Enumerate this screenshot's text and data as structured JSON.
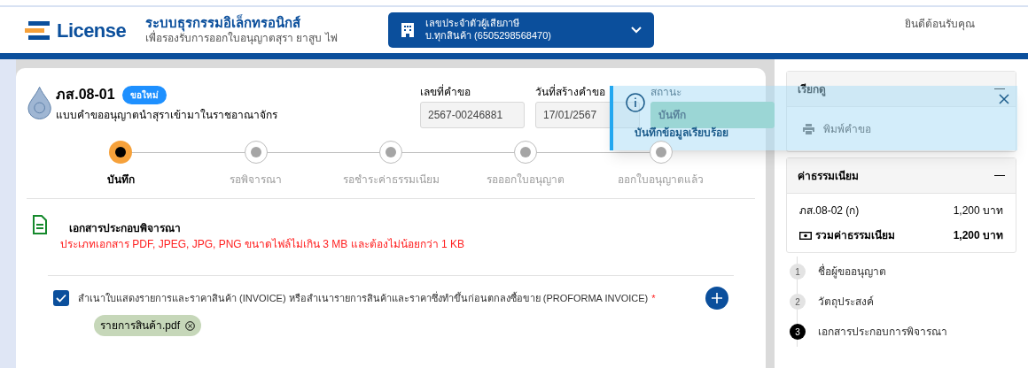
{
  "header": {
    "logo_text": "License",
    "system_title": "ระบบธุรกรรมอิเล็กทรอนิกส์",
    "system_subtitle": "เพื่อรองรับการออกใบอนุญาตสุรา ยาสูบ ไพ่",
    "taxpayer": {
      "label": "เลขประจำตัวผู้เสียภาษี",
      "value": "บ.ทุกสินค้า (6505298568470)"
    },
    "welcome": "ยินดีต้อนรับคุณ"
  },
  "form": {
    "code": "ภส.08-01",
    "badge": "ขอใหม่",
    "title": "แบบคำขออนุญาตนำสุราเข้ามาในราชอาณาจักร",
    "fields": [
      {
        "label": "เลขที่คำขอ",
        "value": "2567-00246881",
        "kind": "plain"
      },
      {
        "label": "วันที่สร้างคำขอ",
        "value": "17/01/2567",
        "kind": "plain"
      },
      {
        "label": "สถานะ",
        "value": "บันทึก",
        "kind": "status"
      }
    ],
    "steps": [
      {
        "label": "บันทึก",
        "selected": true
      },
      {
        "label": "รอพิจารณา",
        "selected": false
      },
      {
        "label": "รอชำระค่าธรรมเนียม",
        "selected": false
      },
      {
        "label": "รอออกใบอนุญาต",
        "selected": false
      },
      {
        "label": "ออกใบอนุญาตแล้ว",
        "selected": false
      }
    ],
    "documents": {
      "title": "เอกสารประกอบพิจารณา",
      "note": "ประเภทเอกสาร PDF, JPEG, JPG, PNG ขนาดไฟล์ไม่เกิน 3 MB และต้องไม่น้อยกว่า 1 KB",
      "items": [
        {
          "label": "สำเนาใบแสดงรายการและราคาสินค้า (INVOICE) หรือสำเนารายการสินค้าและราคาซึ่งทำขึ้นก่อนตกลงซื้อขาย (PROFORMA INVOICE)",
          "required_mark": "*",
          "checked": true,
          "files": [
            "รายการสินค้า.pdf"
          ]
        }
      ]
    }
  },
  "sidebar": {
    "view_panel": {
      "title": "เรียกดู",
      "expanded": true,
      "actions": [
        "พิมพ์คำขอ"
      ]
    },
    "fee_panel": {
      "title": "ค่าธรรมเนียม",
      "expanded": true,
      "rows": [
        {
          "label": "ภส.08-02 (ก)",
          "amount": "1,200 บาท"
        }
      ],
      "total_label": "รวมค่าธรรมเนียม",
      "total_amount": "1,200 บาท"
    },
    "sections": [
      {
        "number": "1",
        "label": "ชื่อผู้ขออนุญาต",
        "selected": false
      },
      {
        "number": "2",
        "label": "วัตถุประสงค์",
        "selected": false
      },
      {
        "number": "3",
        "label": "เอกสารประกอบการพิจารณา",
        "selected": true
      }
    ]
  },
  "toast": {
    "kind": "info",
    "message": "บันทึกข้อมูลเรียบร้อย"
  }
}
